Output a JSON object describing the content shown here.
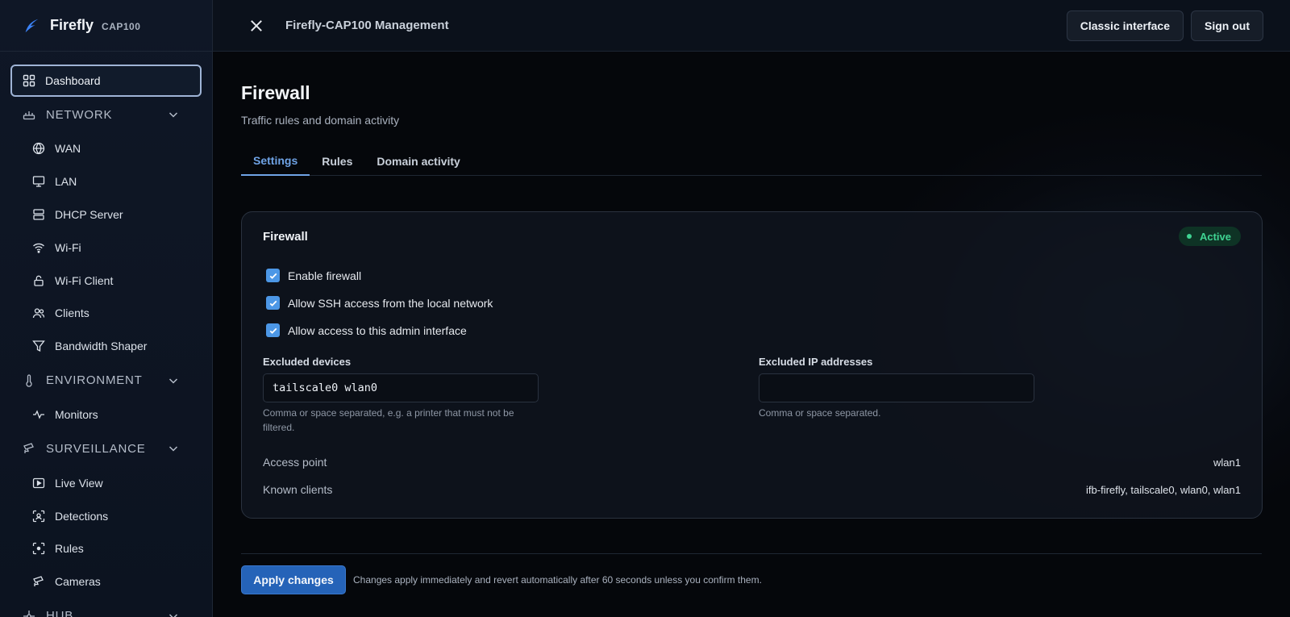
{
  "brand": {
    "name": "Firefly",
    "model": "CAP100"
  },
  "topbar": {
    "title": "Firefly-CAP100 Management",
    "classic_label": "Classic interface",
    "signout_label": "Sign out"
  },
  "sidebar": {
    "dashboard": {
      "label": "Dashboard",
      "icon": "grid-icon"
    },
    "sections": [
      {
        "label": "NETWORK",
        "icon": "network-icon",
        "items": [
          {
            "label": "WAN",
            "icon": "globe-icon"
          },
          {
            "label": "LAN",
            "icon": "monitor-icon"
          },
          {
            "label": "DHCP Server",
            "icon": "server-icon"
          },
          {
            "label": "Wi-Fi",
            "icon": "wifi-icon"
          },
          {
            "label": "Wi-Fi Client",
            "icon": "lock-icon"
          },
          {
            "label": "Clients",
            "icon": "users-icon"
          },
          {
            "label": "Bandwidth Shaper",
            "icon": "filter-icon"
          }
        ]
      },
      {
        "label": "ENVIRONMENT",
        "icon": "thermometer-icon",
        "items": [
          {
            "label": "Monitors",
            "icon": "pulse-icon"
          }
        ]
      },
      {
        "label": "SURVEILLANCE",
        "icon": "cctv-icon",
        "items": [
          {
            "label": "Live View",
            "icon": "play-icon"
          },
          {
            "label": "Detections",
            "icon": "scan-face-icon"
          },
          {
            "label": "Rules",
            "icon": "scan-icon"
          },
          {
            "label": "Cameras",
            "icon": "camera-icon"
          }
        ]
      },
      {
        "label": "HUB",
        "icon": "hub-icon",
        "items": []
      }
    ]
  },
  "page": {
    "title": "Firewall",
    "subtitle": "Traffic rules and domain activity",
    "tabs": [
      "Settings",
      "Rules",
      "Domain activity"
    ],
    "active_tab": "Settings"
  },
  "card": {
    "title": "Firewall",
    "status": "Active",
    "checks": [
      {
        "label": "Enable firewall",
        "checked": true
      },
      {
        "label": "Allow SSH access from the local network",
        "checked": true
      },
      {
        "label": "Allow access to this admin interface",
        "checked": true
      }
    ],
    "excluded_devices": {
      "label": "Excluded devices",
      "value": "tailscale0 wlan0",
      "hint": "Comma or space separated, e.g. a printer that must not be filtered."
    },
    "excluded_ips": {
      "label": "Excluded IP addresses",
      "value": "",
      "hint": "Comma or space separated."
    },
    "info": [
      {
        "label": "Access point",
        "value": "wlan1"
      },
      {
        "label": "Known clients",
        "value": "ifb-firefly, tailscale0, wlan0, wlan1"
      }
    ]
  },
  "footer": {
    "apply_label": "Apply changes",
    "note": "Changes apply immediately and revert automatically after 60 seconds unless you confirm them."
  },
  "colors": {
    "accent": "#4c97e6",
    "status_active": "#3fd392",
    "primary_button": "#2563b8"
  }
}
